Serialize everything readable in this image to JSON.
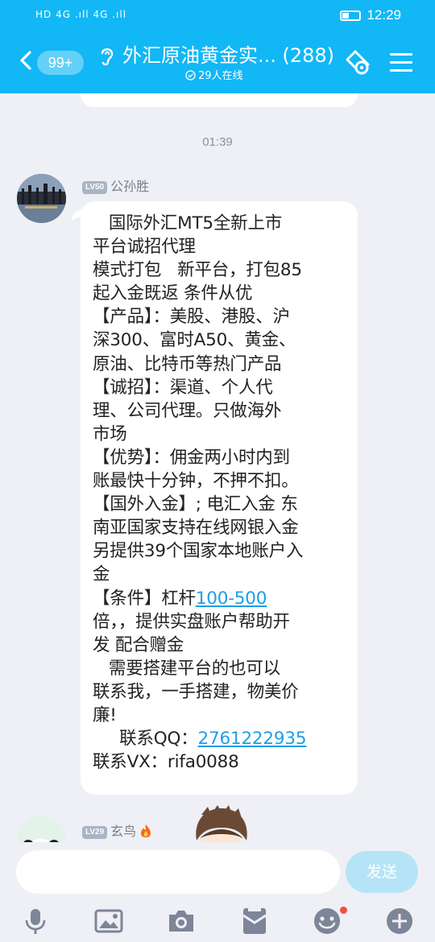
{
  "status_bar": {
    "network": "HD 4G .ıll 4G .ıll",
    "time": "12:29"
  },
  "header": {
    "back_badge": "99+",
    "title": "外汇原油黄金实... (288)",
    "online_count": "29人在线"
  },
  "chat": {
    "timestamp": "01:39",
    "message": {
      "sender_level": "LV50",
      "sender_name": "公孙胜",
      "lines": [
        "   国际外汇MT5全新上市",
        "平台诚招代理",
        "模式打包   新平台，打包85",
        "起入金既返 条件从优",
        "【产品】：美股、港股、沪",
        "深300、富时A50、黄金、",
        "原油、比特币等热门产品",
        "【诚招】：渠道、个人代",
        "理、公司代理。只做海外",
        "市场",
        "【优势】：佣金两小时内到",
        "账最快十分钟，不押不扣。",
        "【国外入金】; 电汇入金 东",
        "南亚国家支持在线网银入金",
        "另提供39个国家本地账户入",
        "金"
      ],
      "leverage_prefix": "【条件】杠杆",
      "leverage_link": "100-500",
      "lines_after": [
        "倍，，提供实盘账户帮助开",
        "发 配合赠金",
        "   需要搭建平台的也可以",
        "联系我，一手搭建，物美价",
        "廉!"
      ],
      "qq_prefix": "     联系QQ：",
      "qq_link": "2761222935",
      "vx_line": "联系VX：rifa0088"
    },
    "next_sender": {
      "level": "LV29",
      "name": "玄鸟"
    }
  },
  "input": {
    "placeholder": "",
    "send_label": "发送"
  },
  "colors": {
    "brand": "#12b7f5",
    "link": "#1e9ee6",
    "background": "#eef0f5",
    "notification_dot": "#f0503c"
  },
  "icons": [
    "back-chevron-icon",
    "ear-icon",
    "group-settings-icon",
    "menu-icon",
    "microphone-icon",
    "image-icon",
    "camera-icon",
    "red-packet-icon",
    "emoji-icon",
    "plus-icon"
  ]
}
